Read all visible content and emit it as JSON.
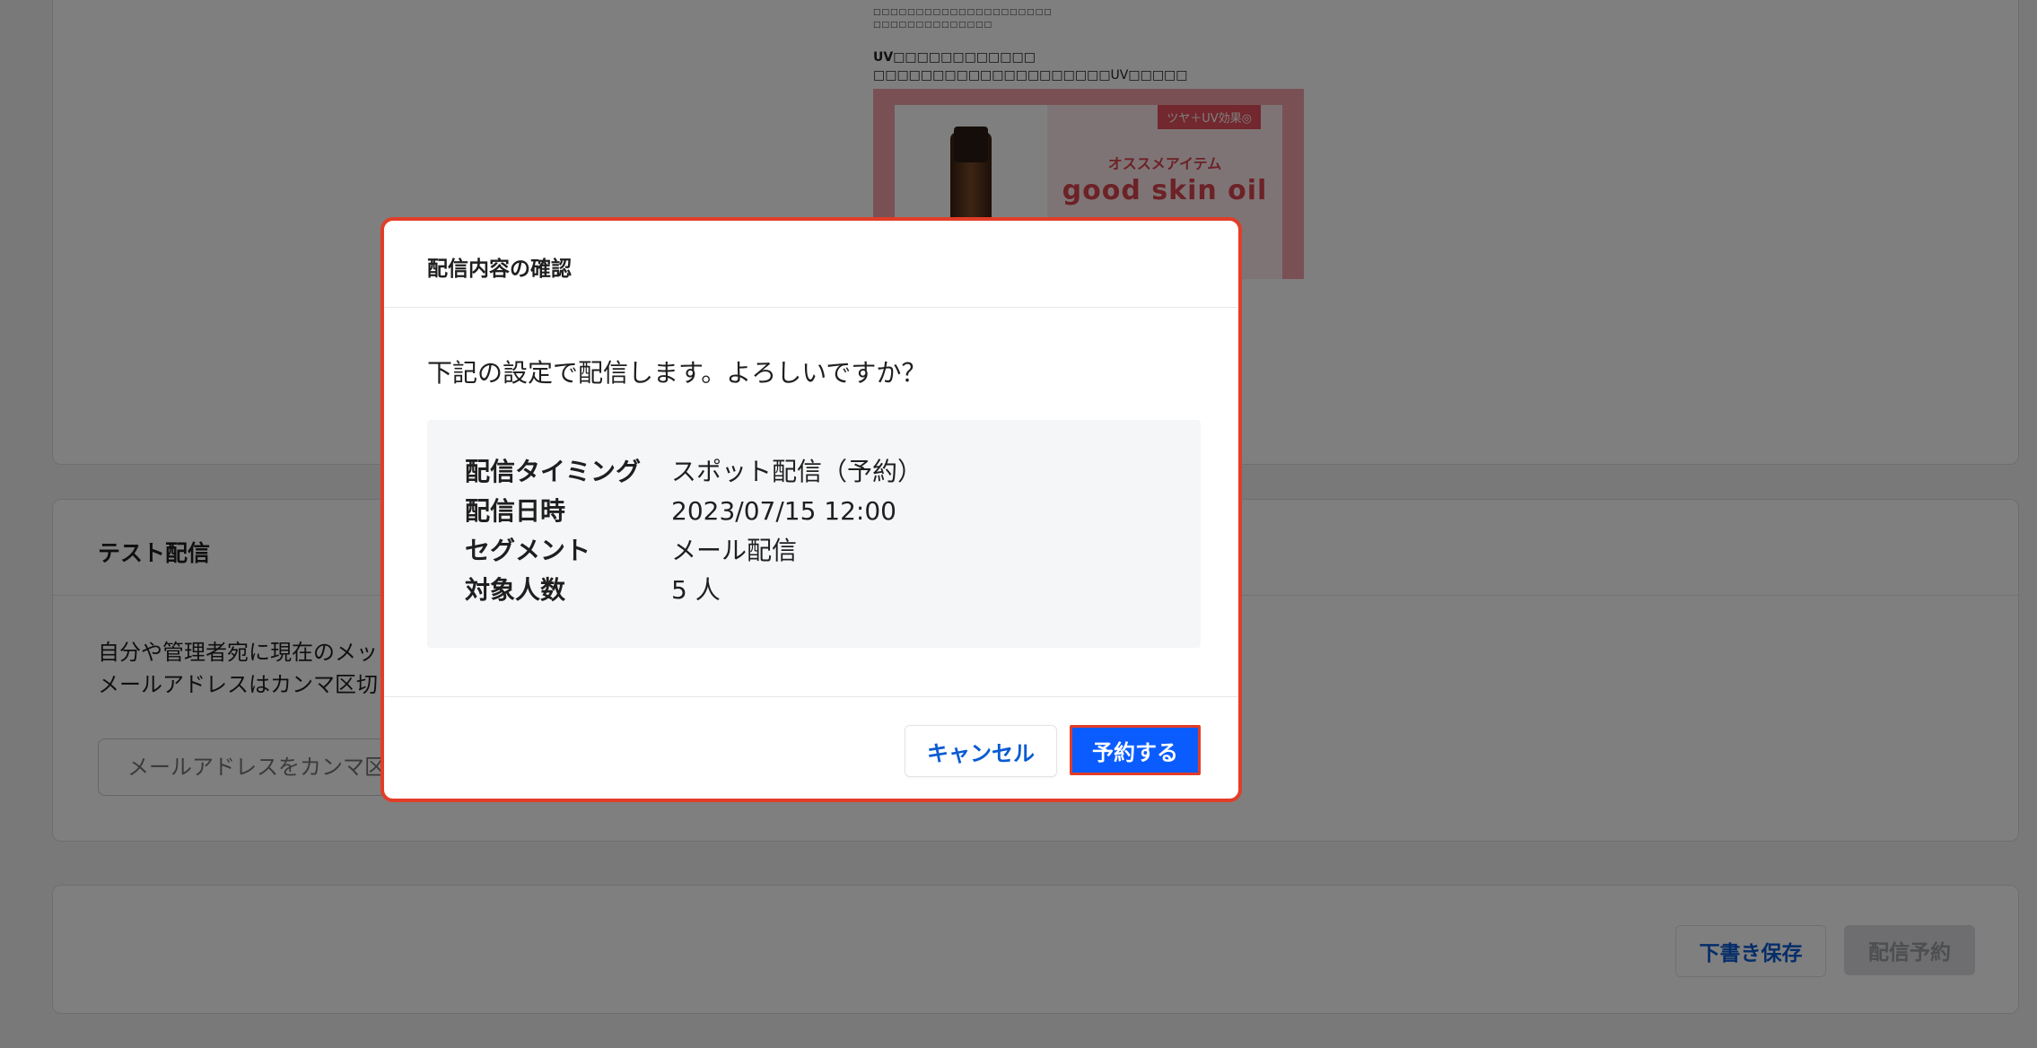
{
  "preview": {
    "tiny_line_1": "□□□□□□□□□□□□□□□□□□□□□",
    "tiny_line_2": "□□□□□□□□□□□□□□",
    "uv_heading": "UV□□□□□□□□□□□□",
    "uv_text": "□□□□□□□□□□□□□□□□□□□□UV□□□□□",
    "badge": "ツヤ＋UV効果◎",
    "recommend": "オススメアイテム",
    "product_name": "good skin oil"
  },
  "test_section": {
    "title": "テスト配信",
    "desc_line_1": "自分や管理者宛に現在のメッ",
    "desc_line_2": "メールアドレスはカンマ区切",
    "email_placeholder": "メールアドレスをカンマ区"
  },
  "footer": {
    "draft_label": "下書き保存",
    "reserve_label": "配信予約"
  },
  "modal": {
    "title": "配信内容の確認",
    "question": "下記の設定で配信します。よろしいですか？",
    "rows": [
      {
        "label": "配信タイミング",
        "value": "スポット配信（予約）"
      },
      {
        "label": "配信日時",
        "value": "2023/07/15 12:00"
      },
      {
        "label": "セグメント",
        "value": "メール配信"
      },
      {
        "label": "対象人数",
        "value": "5 人"
      }
    ],
    "cancel_label": "キャンセル",
    "confirm_label": "予約する"
  },
  "colors": {
    "primary": "#0a5cff",
    "highlight": "#e23d28",
    "link": "#0b5bd3"
  }
}
